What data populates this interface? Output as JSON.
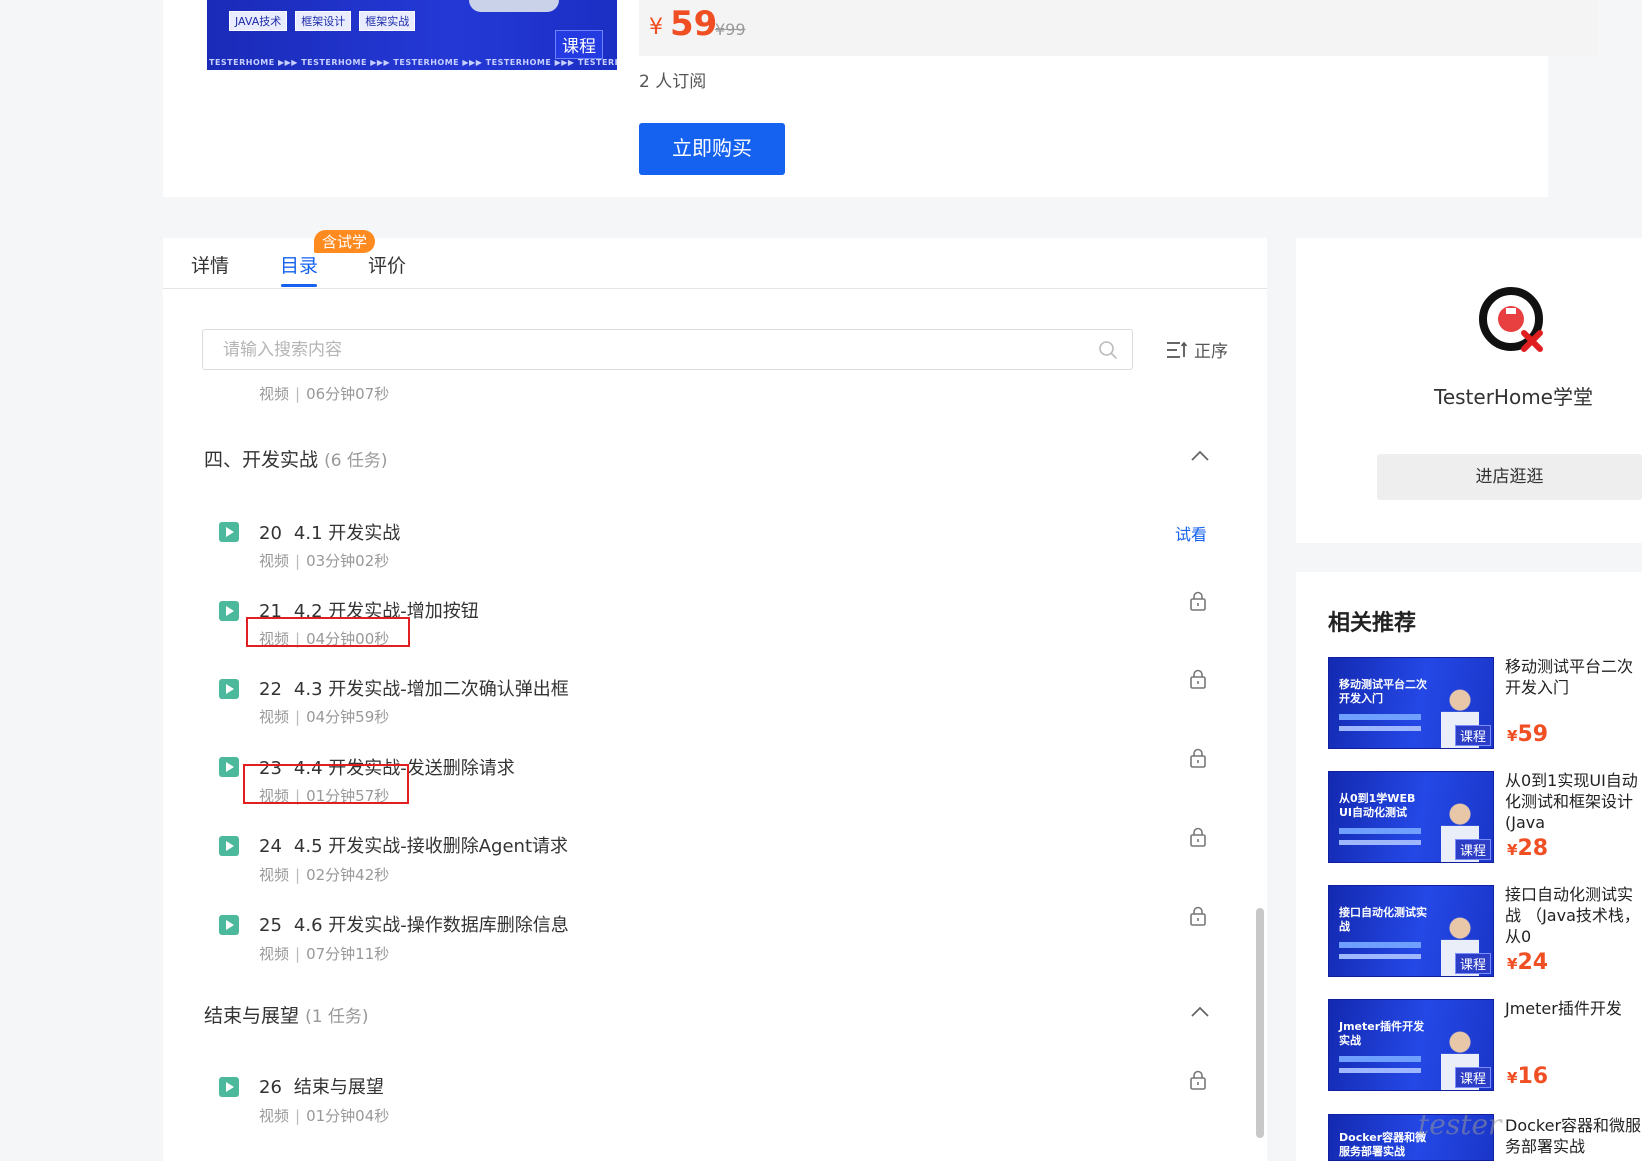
{
  "product": {
    "cover_tags": [
      "JAVA技术",
      "框架设计",
      "框架实战"
    ],
    "cover_strip": "TESTERHOME ▶▶▶ TESTERHOME ▶▶▶ TESTERHOME ▶▶▶ TESTERHOME ▶▶▶ TESTERHOME ▶▶▶",
    "cover_badge": "课程",
    "currency": "¥",
    "price": "59",
    "original_price": "¥99",
    "subscribers": "2 人订阅",
    "buy_label": "立即购买"
  },
  "tabs": {
    "detail": "详情",
    "catalog": "目录",
    "review": "评价",
    "trial_badge": "含试学"
  },
  "search": {
    "placeholder": "请输入搜索内容"
  },
  "sort": {
    "label": "正序"
  },
  "catalog": {
    "leading_meta": {
      "type": "视频",
      "duration": "06分钟07秒"
    },
    "sections": [
      {
        "title": "四、开发实战",
        "count": "(6 任务)",
        "lessons": [
          {
            "num": "20",
            "title": "4.1 开发实战",
            "type": "视频",
            "duration": "03分钟02秒",
            "action": "试看"
          },
          {
            "num": "21",
            "title": "4.2 开发实战-增加按钮",
            "type": "视频",
            "duration": "04分钟00秒"
          },
          {
            "num": "22",
            "title": "4.3 开发实战-增加二次确认弹出框",
            "type": "视频",
            "duration": "04分钟59秒"
          },
          {
            "num": "23",
            "title": "4.4 开发实战-发送删除请求",
            "type": "视频",
            "duration": "01分钟57秒"
          },
          {
            "num": "24",
            "title": "4.5 开发实战-接收删除Agent请求",
            "type": "视频",
            "duration": "02分钟42秒"
          },
          {
            "num": "25",
            "title": "4.6 开发实战-操作数据库删除信息",
            "type": "视频",
            "duration": "07分钟11秒"
          }
        ]
      },
      {
        "title": "结束与展望",
        "count": "(1 任务)",
        "lessons": [
          {
            "num": "26",
            "title": "结束与展望",
            "type": "视频",
            "duration": "01分钟04秒"
          }
        ]
      }
    ]
  },
  "shop": {
    "name": "TesterHome学堂",
    "visit_label": "进店逛逛"
  },
  "recommend": {
    "title": "相关推荐",
    "items": [
      {
        "thumb_text": "移动测试平台二次开发入门",
        "badge": "课程",
        "name": "移动测试平台二次开发入门",
        "currency": "¥",
        "price": "59"
      },
      {
        "thumb_text": "从0到1学WEB UI自动化测试",
        "badge": "课程",
        "name": "从0到1实现UI自动化测试和框架设计 (Java",
        "currency": "¥",
        "price": "28"
      },
      {
        "thumb_text": "接口自动化测试实战",
        "badge": "课程",
        "name": "接口自动化测试实战 （Java技术栈，从0",
        "currency": "¥",
        "price": "24"
      },
      {
        "thumb_text": "Jmeter插件开发实战",
        "badge": "课程",
        "name": "Jmeter插件开发",
        "currency": "¥",
        "price": "16"
      },
      {
        "thumb_text": "Docker容器和微服务部署实战",
        "badge": "课程",
        "name": "Docker容器和微服务部署实战"
      }
    ]
  },
  "watermark": "tester",
  "colors": {
    "accent": "#1462ef",
    "price": "#f04e23",
    "trial": "#ff8a1f",
    "video_icon": "#4cb89c",
    "highlight": "#e02020"
  }
}
